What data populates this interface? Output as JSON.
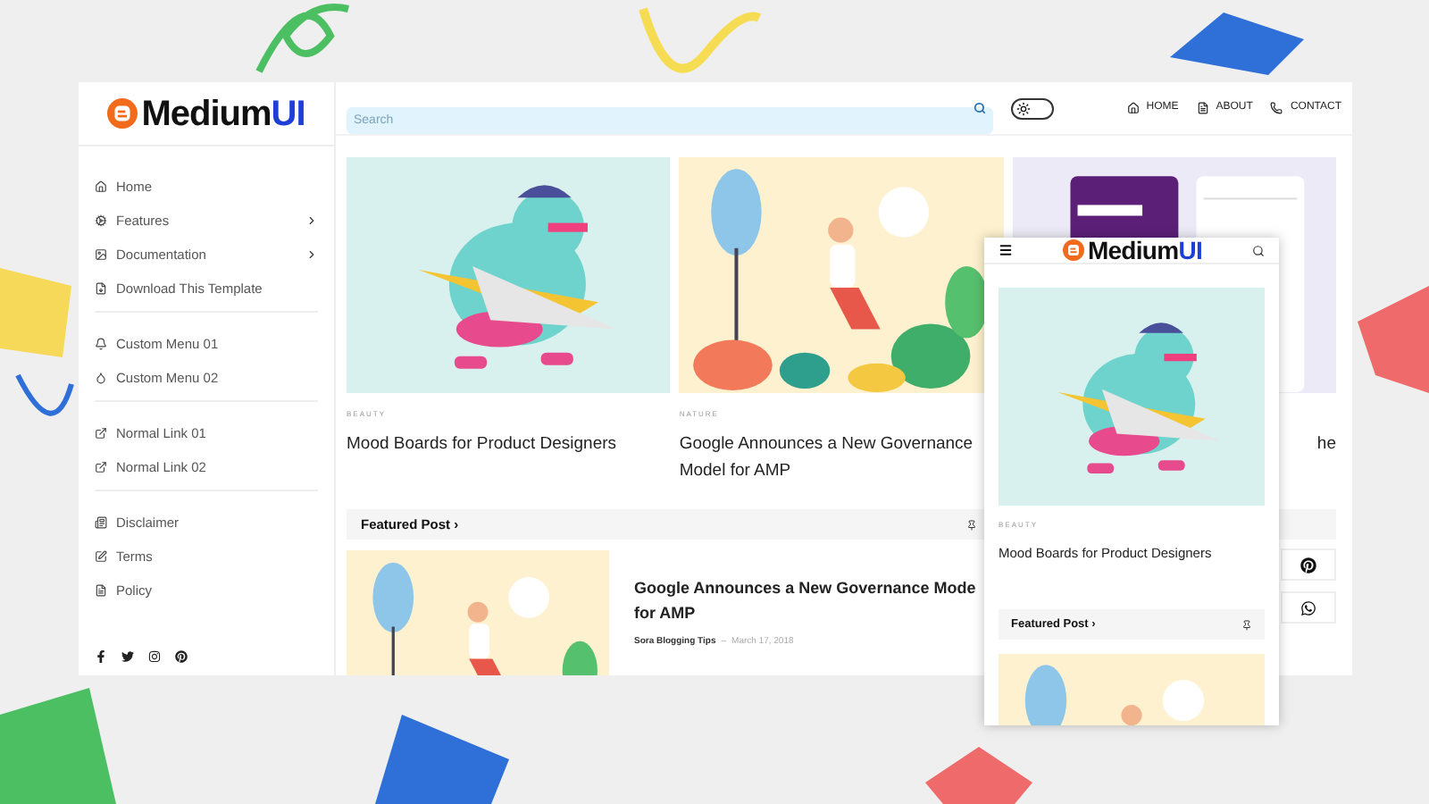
{
  "desktop": {
    "logo": {
      "name": "Medium",
      "accent": "UI"
    },
    "sidebar": {
      "groups": [
        [
          {
            "label": "Home",
            "submenu": false
          },
          {
            "label": "Features",
            "submenu": true
          },
          {
            "label": "Documentation",
            "submenu": true
          },
          {
            "label": "Download This Template",
            "submenu": false
          }
        ],
        [
          {
            "label": "Custom Menu 01",
            "submenu": false
          },
          {
            "label": "Custom Menu 02",
            "submenu": false
          }
        ],
        [
          {
            "label": "Normal Link 01",
            "submenu": false
          },
          {
            "label": "Normal Link 02",
            "submenu": false
          }
        ],
        [
          {
            "label": "Disclaimer",
            "submenu": false
          },
          {
            "label": "Terms",
            "submenu": false
          },
          {
            "label": "Policy",
            "submenu": false
          }
        ]
      ],
      "social": [
        {
          "kind": "facebook"
        },
        {
          "kind": "twitter"
        },
        {
          "kind": "instagram"
        },
        {
          "kind": "pinterest"
        }
      ]
    },
    "header": {
      "search": {
        "placeholder": "Search"
      },
      "theme_toggle": {
        "on": false
      },
      "nav": [
        {
          "label": "HOME"
        },
        {
          "label": "ABOUT"
        },
        {
          "label": "CONTACT"
        }
      ]
    },
    "posts": [
      {
        "category": "BEAUTY",
        "title": "Mood Boards for Product Designers"
      },
      {
        "category": "NATURE",
        "title": "Google Announces a New Governance Model for AMP"
      },
      {
        "title": "he"
      }
    ],
    "featured": {
      "heading": "Featured Post ›",
      "post": {
        "title_lines": [
          "Google Announces a New Governance Mode",
          "for AMP"
        ],
        "author": "Sora Blogging Tips",
        "separator": "–",
        "date": "March 17, 2018"
      }
    },
    "share_buttons": [
      {
        "kind": "pinterest"
      },
      {
        "kind": "whatsapp"
      }
    ]
  },
  "mobile": {
    "logo": {
      "name": "Medium",
      "accent": "UI"
    },
    "post": {
      "category": "BEAUTY",
      "title": "Mood Boards for Product Designers"
    },
    "featured": {
      "heading": "Featured Post ›"
    }
  }
}
